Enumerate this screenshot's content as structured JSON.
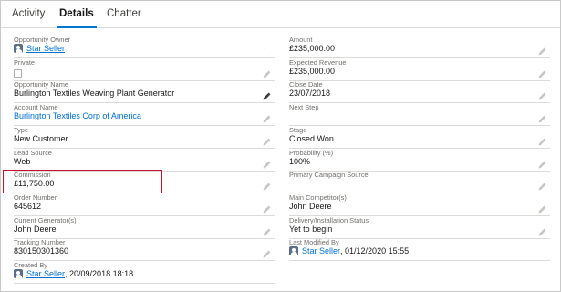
{
  "tabs": [
    {
      "label": "Activity",
      "active": false
    },
    {
      "label": "Details",
      "active": true
    },
    {
      "label": "Chatter",
      "active": false
    }
  ],
  "left": [
    {
      "label": "Opportunity Owner",
      "value": "Star Seller",
      "type": "user-link"
    },
    {
      "label": "Private",
      "value": "",
      "type": "checkbox",
      "checked": false
    },
    {
      "label": "Opportunity Name",
      "value": "Burlington Textiles Weaving Plant Generator",
      "type": "text",
      "edit_dark": true
    },
    {
      "label": "Account Name",
      "value": "Burlington Textiles Corp of America",
      "type": "link"
    },
    {
      "label": "Type",
      "value": "New Customer",
      "type": "text"
    },
    {
      "label": "Lead Source",
      "value": "Web",
      "type": "text"
    },
    {
      "label": "Commission",
      "value": "£11,750.00",
      "type": "text",
      "highlighted": true
    },
    {
      "label": "Order Number",
      "value": "645612",
      "type": "text"
    },
    {
      "label": "Current Generator(s)",
      "value": "John Deere",
      "type": "text"
    },
    {
      "label": "Tracking Number",
      "value": "830150301360",
      "type": "text"
    },
    {
      "label": "Created By",
      "value": "Star Seller",
      "suffix": ", 20/09/2018 18:18",
      "type": "user-link"
    }
  ],
  "right": [
    {
      "label": "Amount",
      "value": "£235,000.00",
      "type": "text"
    },
    {
      "label": "Expected Revenue",
      "value": "£235,000.00",
      "type": "text"
    },
    {
      "label": "Close Date",
      "value": "23/07/2018",
      "type": "text"
    },
    {
      "label": "Next Step",
      "value": "",
      "type": "text"
    },
    {
      "label": "Stage",
      "value": "Closed Won",
      "type": "text"
    },
    {
      "label": "Probability (%)",
      "value": "100%",
      "type": "text"
    },
    {
      "label": "Primary Campaign Source",
      "value": "",
      "type": "text"
    },
    {
      "label": "Main Competitor(s)",
      "value": "John Deere",
      "type": "text"
    },
    {
      "label": "Delivery/Installation Status",
      "value": "Yet to begin",
      "type": "text"
    },
    {
      "label": "Last Modified By",
      "value": "Star Seller",
      "suffix": ", 01/12/2020 15:55",
      "type": "user-link"
    }
  ],
  "colors": {
    "link": "#0070d2",
    "tab_active_underline": "#0176d3",
    "highlight_border": "#c8102e",
    "label": "#706e6b"
  },
  "icons": {
    "edit": "pencil-icon",
    "user": "user-avatar-icon"
  }
}
